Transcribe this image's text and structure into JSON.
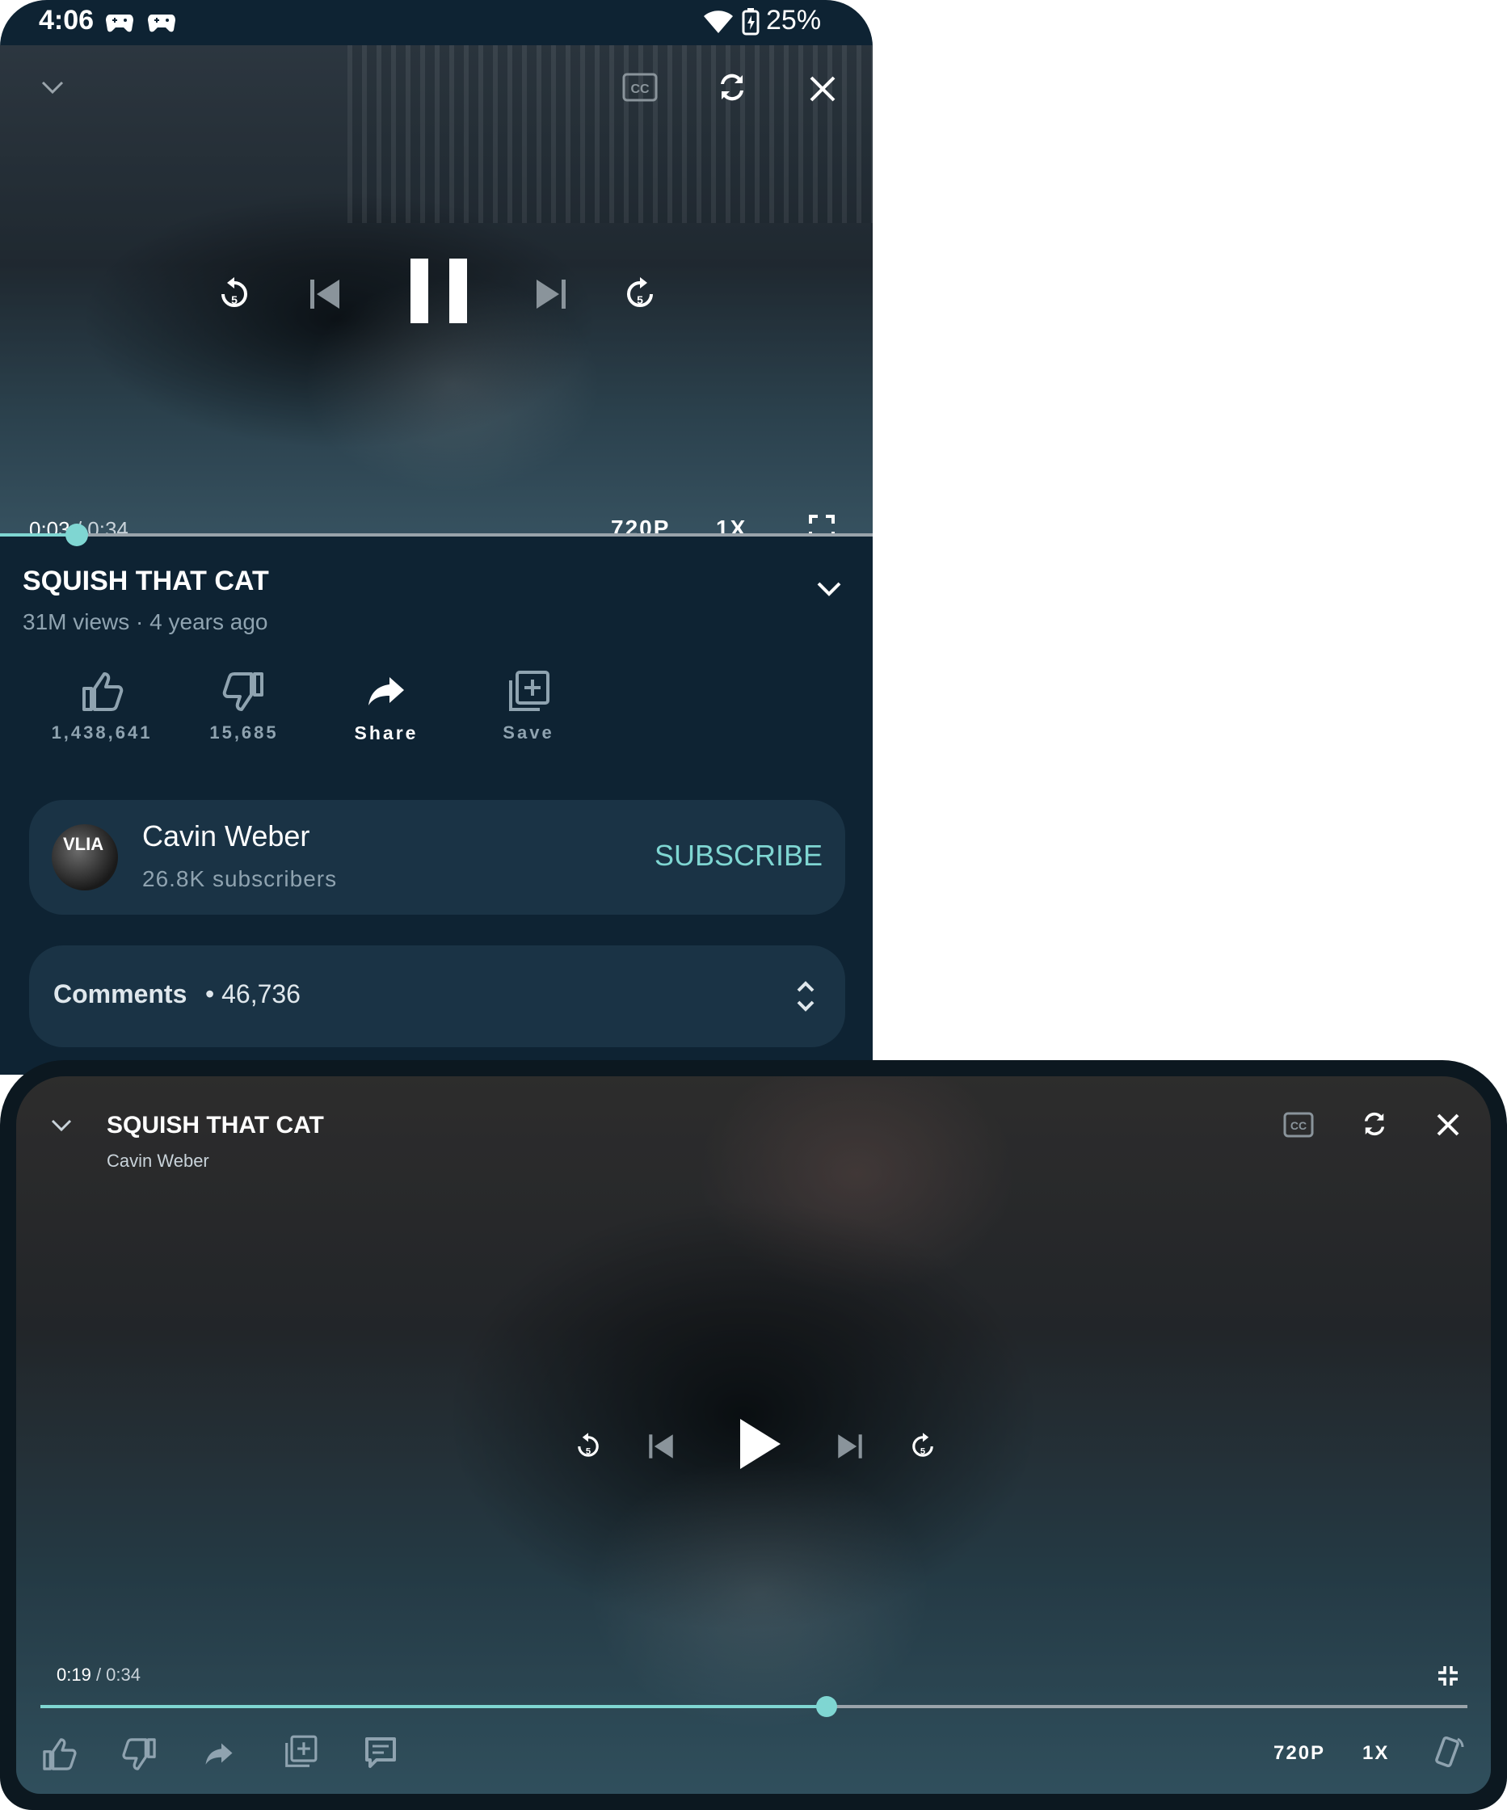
{
  "status_bar": {
    "time": "4:06",
    "battery": "25%"
  },
  "player": {
    "quality": "720P",
    "speed": "1X",
    "portrait_time_current": "0:03",
    "portrait_time_total": "/ 0:34",
    "portrait_progress_fraction": 0.088,
    "landscape_time_current": "0:19",
    "landscape_time_total": "/ 0:34",
    "landscape_progress_fraction": 0.551
  },
  "video": {
    "title": "SQUISH THAT CAT",
    "meta": "31M views · 4 years ago"
  },
  "actions": {
    "like_count": "1,438,641",
    "dislike_count": "15,685",
    "share_label": "Share",
    "save_label": "Save"
  },
  "channel": {
    "name": "Cavin Weber",
    "subscribers": "26.8K subscribers",
    "avatar_text": "VLIA",
    "subscribe_label": "SUBSCRIBE"
  },
  "comments": {
    "label": "Comments",
    "count": "• 46,736"
  },
  "colors": {
    "accent": "#7fd6d2",
    "background": "#0e2333",
    "card": "#1a3345"
  },
  "icons": [
    "chevron-down-icon",
    "closed-captions-icon",
    "autoplay-icon",
    "close-icon",
    "replay-5-icon",
    "skip-previous-icon",
    "pause-icon",
    "play-icon",
    "skip-next-icon",
    "forward-5-icon",
    "fullscreen-icon",
    "exit-fullscreen-icon",
    "thumb-up-icon",
    "thumb-down-icon",
    "share-icon",
    "playlist-add-icon",
    "comment-icon",
    "rotate-icon",
    "wifi-icon",
    "battery-icon",
    "game-controller-icon"
  ]
}
